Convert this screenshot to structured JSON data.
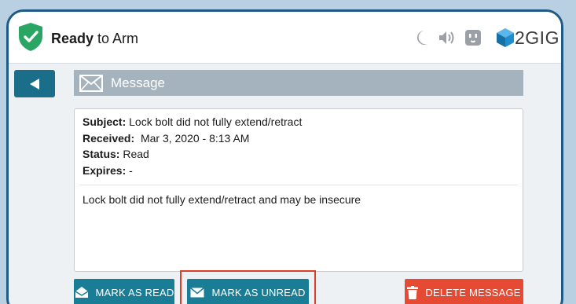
{
  "header": {
    "status_bold": "Ready",
    "status_rest": " to Arm",
    "icons": [
      "shield-check-icon",
      "moon-icon",
      "speaker-icon",
      "outlet-icon",
      "2gig-logo-icon"
    ],
    "brand": "2GIG"
  },
  "message_bar": {
    "title": "Message",
    "icon": "envelope-icon"
  },
  "message": {
    "subject_label": "Subject:",
    "subject": "Lock bolt did not fully extend/retract",
    "received_label": "Received:",
    "received": "Mar 3, 2020 - 8:13 AM",
    "status_label": "Status:",
    "status": "Read",
    "expires_label": "Expires:",
    "expires": "-",
    "body": "Lock bolt did not fully extend/retract and may be insecure"
  },
  "buttons": {
    "mark_read": "MARK AS READ",
    "mark_unread": "MARK AS UNREAD",
    "delete": "DELETE MESSAGE"
  },
  "colors": {
    "accent": "#1a7d96",
    "back": "#1a6e8a",
    "danger": "#e64a32",
    "shield": "#2aa564",
    "highlight": "#d9412b",
    "border": "#1e5a86"
  }
}
